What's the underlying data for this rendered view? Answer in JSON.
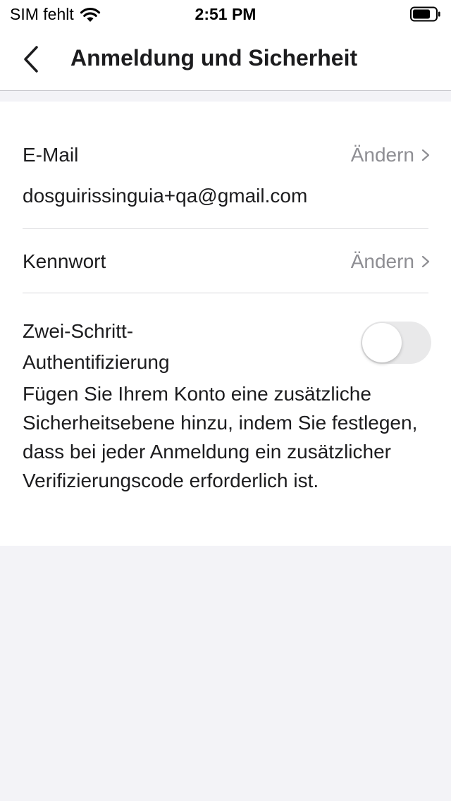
{
  "status_bar": {
    "carrier": "SIM fehlt",
    "time": "2:51 PM"
  },
  "nav": {
    "title": "Anmeldung und Sicherheit"
  },
  "email": {
    "label": "E-Mail",
    "action": "Ändern",
    "value": "dosguirissinguia+qa@gmail.com"
  },
  "password": {
    "label": "Kennwort",
    "action": "Ändern"
  },
  "two_factor": {
    "label": "Zwei-Schritt-Authentifizierung",
    "enabled": false,
    "description": "Fügen Sie Ihrem Konto eine zusätzliche Sicherheitsebene hinzu, indem Sie festlegen, dass bei jeder Anmeldung ein zusätzlicher Verifizierungscode erforderlich ist."
  },
  "colors": {
    "background": "#f3f3f7",
    "card": "#ffffff",
    "secondary_text": "#8e8e93",
    "toggle_off": "#e9e9ea"
  },
  "icons": [
    "wifi-icon",
    "battery-icon",
    "chevron-left-icon",
    "chevron-right-icon"
  ]
}
